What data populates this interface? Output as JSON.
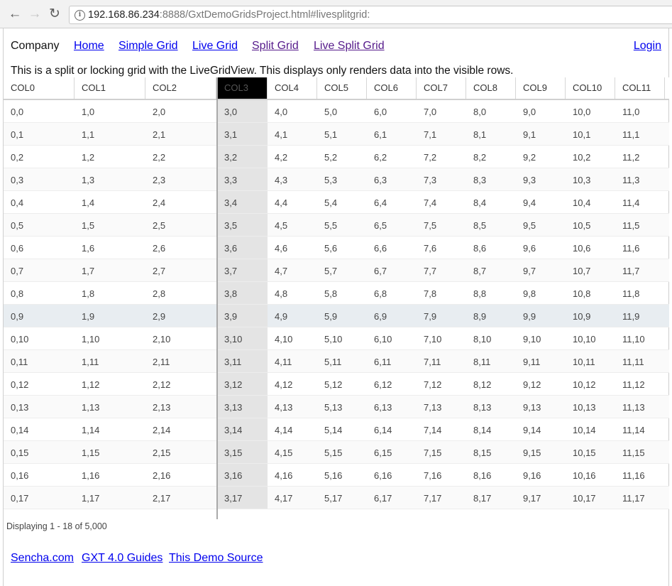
{
  "browser": {
    "url_host": "192.168.86.234",
    "url_rest": ":8888/GxtDemoGridsProject.html#livesplitgrid:"
  },
  "nav": {
    "brand": "Company",
    "links": [
      "Home",
      "Simple Grid",
      "Live Grid",
      "Split Grid",
      "Live Split Grid"
    ],
    "login": "Login"
  },
  "description": "This is a split or locking grid with the LiveGridView. This displays only renders data into the visible rows.",
  "grid": {
    "columns": [
      "COL0",
      "COL1",
      "COL2",
      "COL3",
      "COL4",
      "COL5",
      "COL6",
      "COL7",
      "COL8",
      "COL9",
      "COL10",
      "COL11"
    ],
    "sorted_column": "COL3",
    "selected_row": 9,
    "rows": [
      [
        "0,0",
        "1,0",
        "2,0",
        "3,0",
        "4,0",
        "5,0",
        "6,0",
        "7,0",
        "8,0",
        "9,0",
        "10,0",
        "11,0"
      ],
      [
        "0,1",
        "1,1",
        "2,1",
        "3,1",
        "4,1",
        "5,1",
        "6,1",
        "7,1",
        "8,1",
        "9,1",
        "10,1",
        "11,1"
      ],
      [
        "0,2",
        "1,2",
        "2,2",
        "3,2",
        "4,2",
        "5,2",
        "6,2",
        "7,2",
        "8,2",
        "9,2",
        "10,2",
        "11,2"
      ],
      [
        "0,3",
        "1,3",
        "2,3",
        "3,3",
        "4,3",
        "5,3",
        "6,3",
        "7,3",
        "8,3",
        "9,3",
        "10,3",
        "11,3"
      ],
      [
        "0,4",
        "1,4",
        "2,4",
        "3,4",
        "4,4",
        "5,4",
        "6,4",
        "7,4",
        "8,4",
        "9,4",
        "10,4",
        "11,4"
      ],
      [
        "0,5",
        "1,5",
        "2,5",
        "3,5",
        "4,5",
        "5,5",
        "6,5",
        "7,5",
        "8,5",
        "9,5",
        "10,5",
        "11,5"
      ],
      [
        "0,6",
        "1,6",
        "2,6",
        "3,6",
        "4,6",
        "5,6",
        "6,6",
        "7,6",
        "8,6",
        "9,6",
        "10,6",
        "11,6"
      ],
      [
        "0,7",
        "1,7",
        "2,7",
        "3,7",
        "4,7",
        "5,7",
        "6,7",
        "7,7",
        "8,7",
        "9,7",
        "10,7",
        "11,7"
      ],
      [
        "0,8",
        "1,8",
        "2,8",
        "3,8",
        "4,8",
        "5,8",
        "6,8",
        "7,8",
        "8,8",
        "9,8",
        "10,8",
        "11,8"
      ],
      [
        "0,9",
        "1,9",
        "2,9",
        "3,9",
        "4,9",
        "5,9",
        "6,9",
        "7,9",
        "8,9",
        "9,9",
        "10,9",
        "11,9"
      ],
      [
        "0,10",
        "1,10",
        "2,10",
        "3,10",
        "4,10",
        "5,10",
        "6,10",
        "7,10",
        "8,10",
        "9,10",
        "10,10",
        "11,10"
      ],
      [
        "0,11",
        "1,11",
        "2,11",
        "3,11",
        "4,11",
        "5,11",
        "6,11",
        "7,11",
        "8,11",
        "9,11",
        "10,11",
        "11,11"
      ],
      [
        "0,12",
        "1,12",
        "2,12",
        "3,12",
        "4,12",
        "5,12",
        "6,12",
        "7,12",
        "8,12",
        "9,12",
        "10,12",
        "11,12"
      ],
      [
        "0,13",
        "1,13",
        "2,13",
        "3,13",
        "4,13",
        "5,13",
        "6,13",
        "7,13",
        "8,13",
        "9,13",
        "10,13",
        "11,13"
      ],
      [
        "0,14",
        "1,14",
        "2,14",
        "3,14",
        "4,14",
        "5,14",
        "6,14",
        "7,14",
        "8,14",
        "9,14",
        "10,14",
        "11,14"
      ],
      [
        "0,15",
        "1,15",
        "2,15",
        "3,15",
        "4,15",
        "5,15",
        "6,15",
        "7,15",
        "8,15",
        "9,15",
        "10,15",
        "11,15"
      ],
      [
        "0,16",
        "1,16",
        "2,16",
        "3,16",
        "4,16",
        "5,16",
        "6,16",
        "7,16",
        "8,16",
        "9,16",
        "10,16",
        "11,16"
      ],
      [
        "0,17",
        "1,17",
        "2,17",
        "3,17",
        "4,17",
        "5,17",
        "6,17",
        "7,17",
        "8,17",
        "9,17",
        "10,17",
        "11,17"
      ]
    ]
  },
  "paging_text": "Displaying 1 - 18 of 5,000",
  "footer_links": [
    "Sencha.com",
    "GXT 4.0 Guides",
    "This Demo Source"
  ]
}
